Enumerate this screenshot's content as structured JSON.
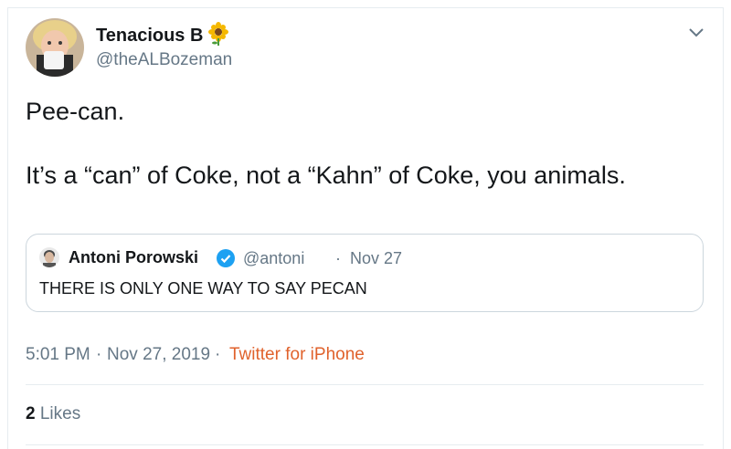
{
  "tweet": {
    "author": {
      "name": "Tenacious B",
      "handle": "@theALBozeman",
      "emoji": "sunflower-icon"
    },
    "text_line1": "Pee-can.",
    "text_line2": "It’s a “can” of Coke, not a “Kahn” of Coke, you animals.",
    "quote": {
      "name": "Antoni Porowski",
      "verified": true,
      "handle": "@antoni",
      "separator": "·",
      "date": "Nov 27",
      "text": "THERE IS ONLY ONE WAY TO SAY PECAN"
    },
    "meta": {
      "time": "5:01 PM",
      "date": "Nov 27, 2019",
      "separator": "·",
      "source": "Twitter for iPhone"
    },
    "likes": {
      "count": "2",
      "label": "Likes"
    }
  },
  "colors": {
    "text": "#14171a",
    "secondary": "#657786",
    "source_link": "#e0622c",
    "verified": "#1da1f2",
    "border": "#e6ecf0"
  }
}
